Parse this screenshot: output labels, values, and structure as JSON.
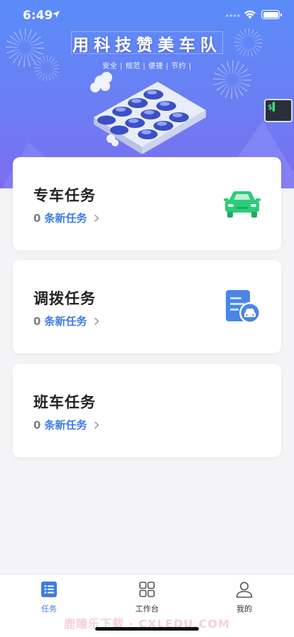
{
  "status_bar": {
    "time": "6:49"
  },
  "banner": {
    "slogan": "用科技赞美车队",
    "sub_slogan": "安全 | 规范 | 便捷 | 节约 |"
  },
  "tasks": [
    {
      "title": "专车任务",
      "count": "0",
      "count_label": "条新任务",
      "icon": "car-icon"
    },
    {
      "title": "调拨任务",
      "count": "0",
      "count_label": "条新任务",
      "icon": "transfer-document-icon"
    },
    {
      "title": "班车任务",
      "count": "0",
      "count_label": "条新任务"
    }
  ],
  "tabbar": {
    "items": [
      {
        "label": "任务",
        "icon": "task-list-icon",
        "active": true
      },
      {
        "label": "工作台",
        "icon": "grid-icon",
        "active": false
      },
      {
        "label": "我的",
        "icon": "user-icon",
        "active": false
      }
    ]
  },
  "watermark": "鹿瞳乐下载 · CXLEDU.COM",
  "colors": {
    "accent": "#3f7ce6",
    "banner_top": "#5a8cf9",
    "banner_bottom": "#7d6cf0",
    "car_green": "#2dcc7a"
  }
}
